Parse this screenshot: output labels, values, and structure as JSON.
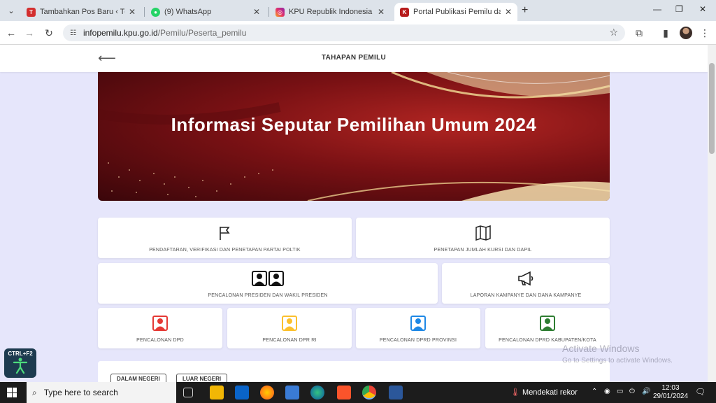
{
  "browser": {
    "tabs": [
      {
        "label": "Tambahkan Pos Baru ‹ Teropong",
        "favicon": "pen-icon",
        "favicon_color": "#d32f2f"
      },
      {
        "label": "(9) WhatsApp",
        "favicon": "whatsapp-icon",
        "favicon_color": "#25d366"
      },
      {
        "label": "KPU Republik Indonesia (@kpu_",
        "favicon": "instagram-icon",
        "favicon_color": "#e1306c"
      },
      {
        "label": "Portal Publikasi Pemilu dan Pem",
        "favicon": "kpu-icon",
        "favicon_color": "#b71c1c"
      }
    ],
    "active_tab": 3,
    "url_host": "infopemilu.kpu.go.id",
    "url_path": "/Pemilu/Peserta_pemilu"
  },
  "page": {
    "header_title": "TAHAPAN PEMILU",
    "banner_title": "Informasi Seputar Pemilihan Umum 2024",
    "cards": [
      {
        "label": "PENDAFTARAN, VERIFIKASI DAN PENETAPAN PARTAI POLTIK",
        "icon": "flag-icon"
      },
      {
        "label": "PENETAPAN JUMLAH KURSI DAN DAPIL",
        "icon": "map-icon"
      },
      {
        "label": "PENCALONAN PRESIDEN DAN WAKIL PRESIDEN",
        "icon": "two-person-icon"
      },
      {
        "label": "LAPORAN KAMPANYE DAN DANA KAMPANYE",
        "icon": "megaphone-icon"
      },
      {
        "label": "PENCALONAN DPD",
        "icon": "person-card-icon",
        "color": "#e53935"
      },
      {
        "label": "PENCALONAN DPR RI",
        "icon": "person-card-icon",
        "color": "#fbc02d"
      },
      {
        "label": "PENCALONAN DPRD PROVINSI",
        "icon": "person-card-icon",
        "color": "#1e88e5"
      },
      {
        "label": "PENCALONAN DPRD KABUPATEN/KOTA",
        "icon": "person-card-icon",
        "color": "#2e7d32"
      }
    ],
    "subtabs": [
      "DALAM NEGERI",
      "LUAR NEGERI"
    ],
    "accessibility_label": "CTRL+F2"
  },
  "windows": {
    "watermark_title": "Activate Windows",
    "watermark_sub": "Go to Settings to activate Windows.",
    "search_placeholder": "Type here to search",
    "weather": "Mendekati rekor",
    "time": "12:03",
    "date": "29/01/2024"
  }
}
